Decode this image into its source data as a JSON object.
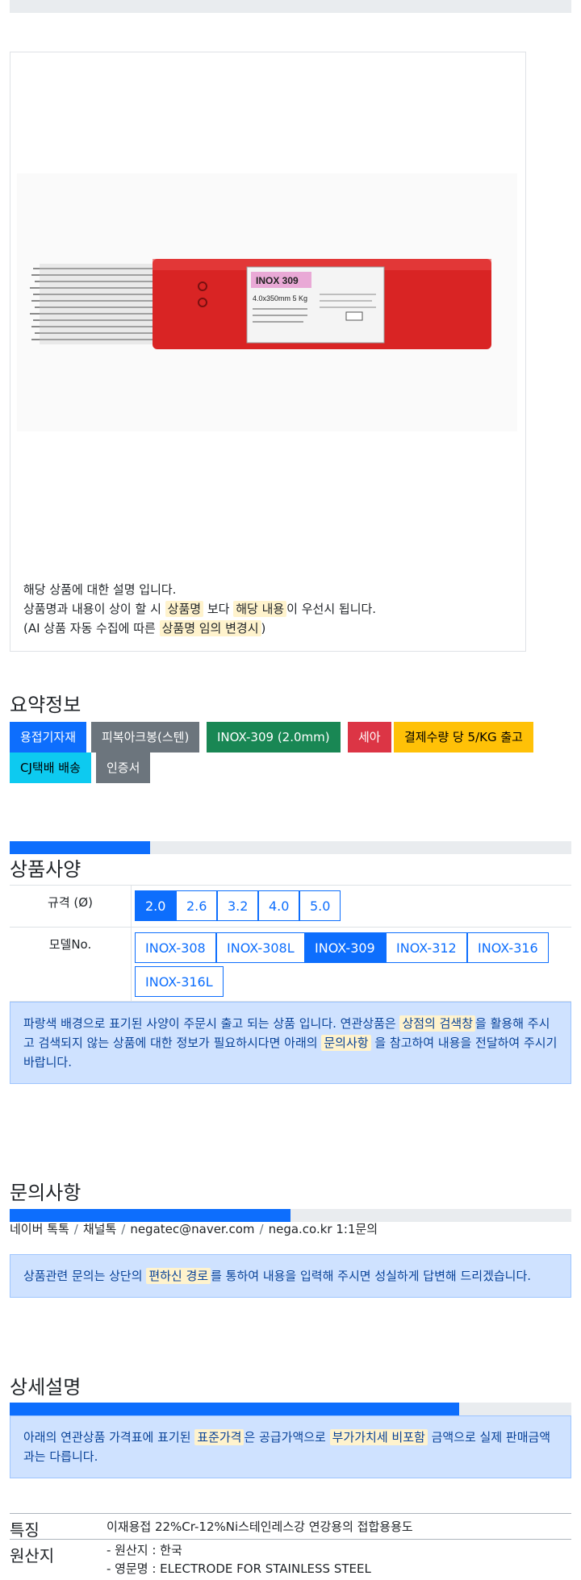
{
  "product": {
    "image_alt": "INOX 309 용접봉 제품 이미지",
    "box_label": "INOX 309",
    "box_spec": "4.0x350mm  5 Kg",
    "description": {
      "line1": "해당 상품에 대한 설명 입니다.",
      "line2_a": "상품명과 내용이 상이 할 시 ",
      "line2_hl1": "상품명",
      "line2_b": " 보다 ",
      "line2_hl2": "해당 내용",
      "line2_c": "이 우선시 됩니다.",
      "line3_a": "(AI 상품 자동 수집에 따른 ",
      "line3_hl": "상품명 임의 변경시",
      "line3_b": ")"
    }
  },
  "summary": {
    "title": "요약정보",
    "badges": [
      {
        "label": "용접기자재",
        "color": "#0d6efd"
      },
      {
        "label": "피복아크봉(스텐)",
        "color": "#6c757d"
      },
      {
        "label": "INOX-309 (2.0mm)",
        "color": "#198754"
      },
      {
        "label": "세아",
        "color": "#dc3545"
      },
      {
        "label": "결제수량 당 5/KG 출고",
        "color": "#ffc107"
      },
      {
        "label": "CJ택배 배송",
        "color": "#0dcaf0"
      },
      {
        "label": "인증서",
        "color": "#6c757d"
      }
    ]
  },
  "spec": {
    "title": "상품사양",
    "progress": 0.25,
    "size_label": "규격 (Ø)",
    "sizes": [
      "2.0",
      "2.6",
      "3.2",
      "4.0",
      "5.0"
    ],
    "size_selected": "2.0",
    "model_label": "모델No.",
    "models": [
      "INOX-308",
      "INOX-308L",
      "INOX-309",
      "INOX-312",
      "INOX-316",
      "INOX-316L"
    ],
    "model_selected": "INOX-309",
    "notice": {
      "a": "파랑색 배경으로 표기된 사양이 주문시 출고 되는 상품 입니다. 연관상품은 ",
      "hl1": "상점의 검색창",
      "b": "을 활용해 주시고 검색되지 않는 상품에 대한 정보가 필요하시다면 아래의 ",
      "hl2": "문의사항",
      "c": " 을 참고하여 내용을 전달하여 주시기 바랍니다."
    }
  },
  "inquiry": {
    "title": "문의사항",
    "progress": 0.5,
    "links": [
      "네이버 톡톡",
      "채널톡",
      "negatec@naver.com",
      "nega.co.kr 1:1문의"
    ],
    "separator": "/",
    "notice": {
      "a": "상품관련 문의는 상단의 ",
      "hl": "편하신 경로",
      "b": "를 통하여 내용을 입력해 주시면 성실하게 답변해 드리겠습니다."
    }
  },
  "detail": {
    "title": "상세설명",
    "progress": 0.8,
    "notice": {
      "a": "아래의 연관상품 가격표에 표기된 ",
      "hl1": "표준가격",
      "b": "은 공급가액으로 ",
      "hl2": "부가가치세 비포함",
      "c": " 금액으로 실제 판매금액과는 다릅니다."
    },
    "rows": [
      {
        "key": "특징",
        "values": [
          "이재용접 22%Cr-12%Ni스테인레스강 연강용의 접합용용도"
        ]
      },
      {
        "key": "원산지",
        "values": [
          "- 원산지 : 한국",
          "- 영문명 : ELECTRODE FOR STAINLESS STEEL"
        ]
      }
    ]
  }
}
